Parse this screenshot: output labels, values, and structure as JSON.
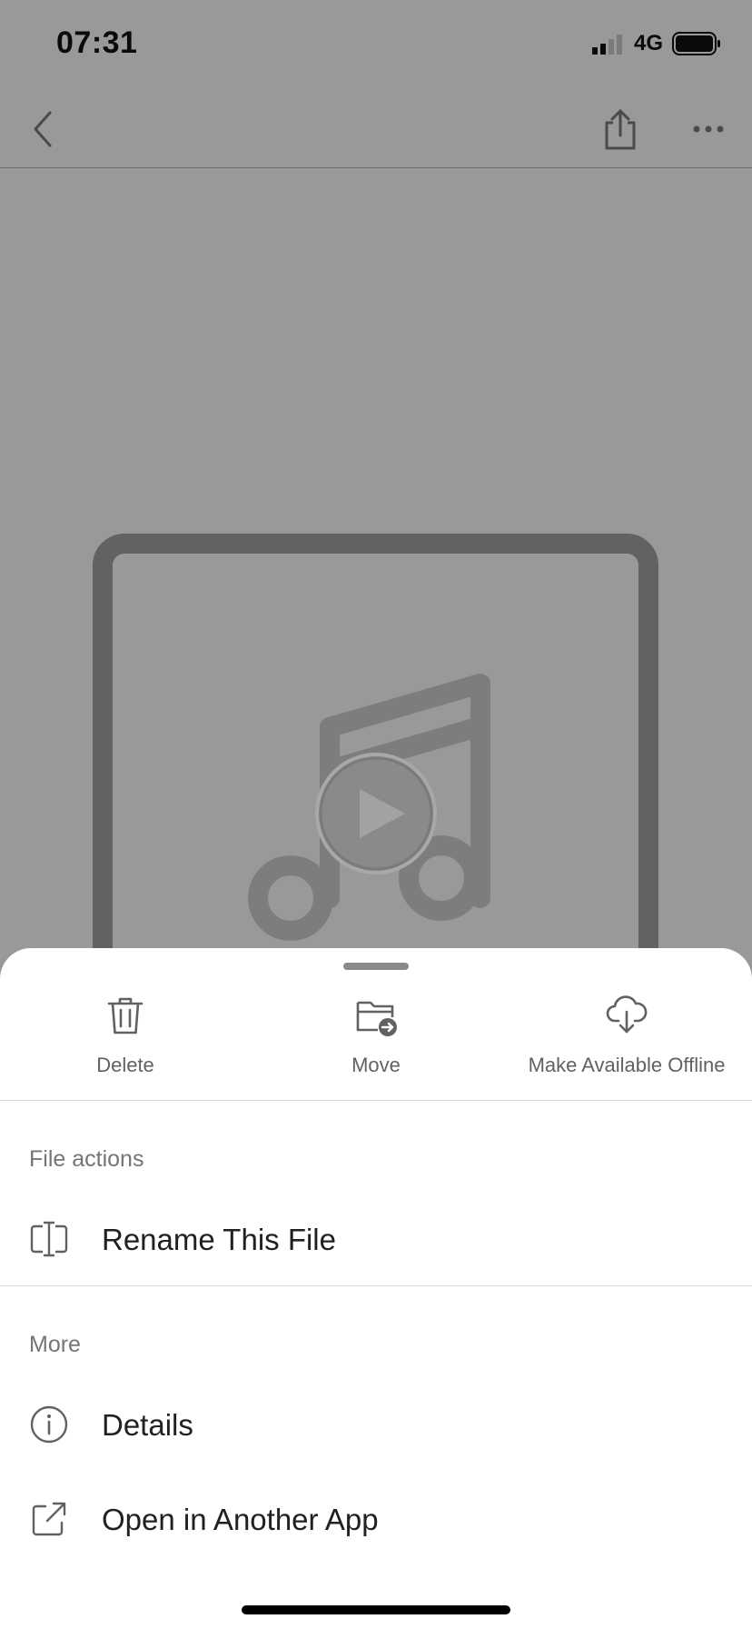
{
  "status_bar": {
    "time": "07:31",
    "network": "4G",
    "icons": [
      "signal-icon",
      "battery-icon"
    ]
  },
  "nav_bar": {
    "icons": [
      "back-chevron-icon",
      "share-icon",
      "more-icon"
    ]
  },
  "preview": {
    "icons": [
      "music-note-icon",
      "play-icon"
    ]
  },
  "sheet": {
    "quick_actions": [
      {
        "label": "Delete",
        "icon": "trash-icon"
      },
      {
        "label": "Move",
        "icon": "move-folder-icon"
      },
      {
        "label": "Make Available Offline",
        "icon": "cloud-download-icon"
      }
    ],
    "file_actions": {
      "title": "File actions",
      "items": [
        {
          "label": "Rename This File",
          "icon": "rename-icon"
        }
      ]
    },
    "more": {
      "title": "More",
      "items": [
        {
          "label": "Details",
          "icon": "info-icon"
        },
        {
          "label": "Open in Another App",
          "icon": "open-external-icon"
        }
      ]
    }
  },
  "colors": {
    "dimmed_background": "#999999",
    "sheet_background": "#ffffff",
    "label_gray": "#616161",
    "text_dark": "#212121"
  }
}
